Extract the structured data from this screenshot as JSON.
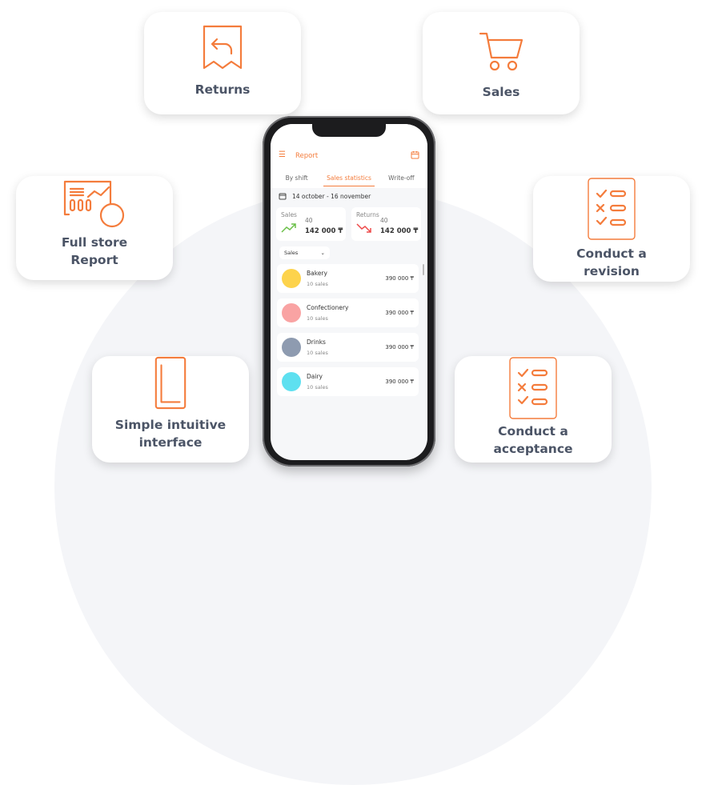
{
  "features": [
    {
      "label": "Returns",
      "icon": "receipt-return-icon"
    },
    {
      "label": "Sales",
      "icon": "shopping-cart-icon"
    },
    {
      "label": "Full store Report",
      "icon": "report-chart-icon"
    },
    {
      "label": "Conduct a revision",
      "icon": "checklist-icon"
    },
    {
      "label": "Simple intuitive interface",
      "icon": "phone-icon"
    },
    {
      "label": "Conduct a acceptance",
      "icon": "checklist-icon"
    }
  ],
  "app": {
    "title": "Report",
    "tabs": [
      "By shift",
      "Sales statistics",
      "Write-off"
    ],
    "active_tab": "Sales statistics",
    "date_range": "14 october - 16 november",
    "sales": {
      "label": "Sales",
      "count": "40",
      "amount": "142 000 ₸"
    },
    "returns": {
      "label": "Returns",
      "count": "40",
      "amount": "142 000 ₸"
    },
    "filter": "Sales",
    "items": [
      {
        "name": "Bakery",
        "sub": "10 sales",
        "amount": "390 000 ₸",
        "color": "#fdd34c"
      },
      {
        "name": "Confectionery",
        "sub": "10 sales",
        "amount": "390 000 ₸",
        "color": "#f9a3a3"
      },
      {
        "name": "Drinks",
        "sub": "10 sales",
        "amount": "390 000 ₸",
        "color": "#8e9bb0"
      },
      {
        "name": "Dairy",
        "sub": "10 sales",
        "amount": "390 000 ₸",
        "color": "#5ee0f0"
      }
    ],
    "accent": "#f47c3c"
  }
}
